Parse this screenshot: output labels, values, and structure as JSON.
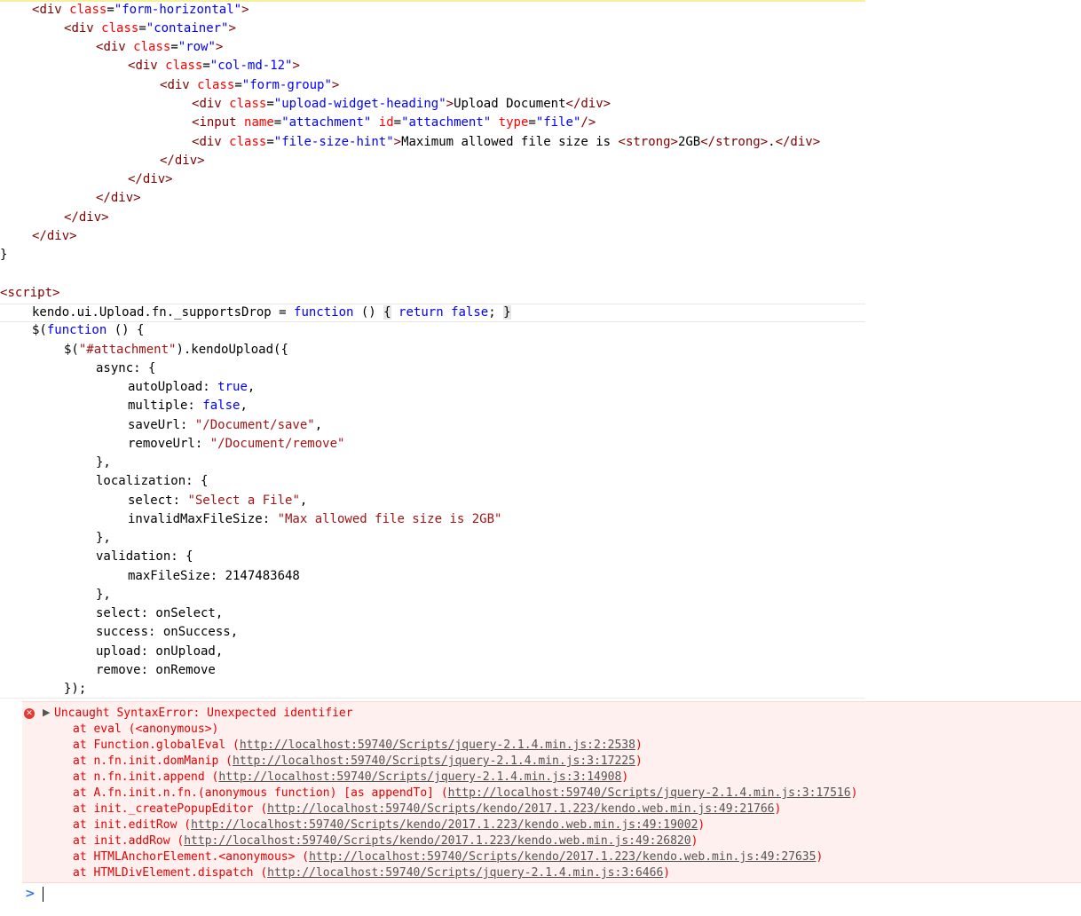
{
  "code": {
    "html": {
      "l1": {
        "tag": "div",
        "attr": "class",
        "val": "\"form-horizontal\""
      },
      "l2": {
        "tag": "div",
        "attr": "class",
        "val": "\"container\""
      },
      "l3": {
        "tag": "div",
        "attr": "class",
        "val": "\"row\""
      },
      "l4": {
        "tag": "div",
        "attr": "class",
        "val": "\"col-md-12\""
      },
      "l5": {
        "tag": "div",
        "attr": "class",
        "val": "\"form-group\""
      },
      "l6": {
        "tag": "div",
        "attr": "class",
        "val": "\"upload-widget-heading\"",
        "text": "Upload Document"
      },
      "l7": {
        "tag": "input",
        "attr1": "name",
        "val1": "\"attachment\"",
        "attr2": "id",
        "val2": "\"attachment\"",
        "attr3": "type",
        "val3": "\"file\""
      },
      "l8": {
        "tag": "div",
        "attr": "class",
        "val": "\"file-size-hint\"",
        "text": "Maximum allowed file size is ",
        "strong_tag": "strong",
        "strong_text": "2GB",
        "after": "."
      },
      "close_div": "div",
      "close_brace": "}",
      "script_tag": "script"
    },
    "js": {
      "supports_drop_pre": "kendo.ui.Upload.fn._supportsDrop = ",
      "kw_function": "function",
      "kw_return": "return",
      "kw_false": "false",
      "kw_true": "true",
      "selector_pre": "$(",
      "selector_str": "\"#attachment\"",
      "selector_post": ").kendoUpload({",
      "async_key": "async: {",
      "autoUpload": "autoUpload: ",
      "multiple": "multiple: ",
      "saveUrl": "saveUrl: ",
      "saveUrl_val": "\"/Document/save\"",
      "removeUrl": "removeUrl: ",
      "removeUrl_val": "\"/Document/remove\"",
      "localization_key": "localization: {",
      "select_key": "select: ",
      "select_val": "\"Select a File\"",
      "invalid_key": "invalidMaxFileSize: ",
      "invalid_val": "\"Max allowed file size is 2GB\"",
      "validation_key": "validation: {",
      "maxsize_line": "maxFileSize: 2147483648",
      "on_select": "select: onSelect,",
      "on_success": "success: onSuccess,",
      "on_upload": "upload: onUpload,",
      "on_remove": "remove: onRemove",
      "close_obj": "},",
      "close_call": "});"
    }
  },
  "console": {
    "error_message": "Uncaught SyntaxError: Unexpected identifier",
    "error_icon": "error-x-icon",
    "stack": [
      {
        "pre": "at eval (<anonymous>)",
        "link": "",
        "post": ""
      },
      {
        "pre": "at Function.globalEval (",
        "link": "http://localhost:59740/Scripts/jquery-2.1.4.min.js:2:2538",
        "post": ")"
      },
      {
        "pre": "at n.fn.init.domManip (",
        "link": "http://localhost:59740/Scripts/jquery-2.1.4.min.js:3:17225",
        "post": ")"
      },
      {
        "pre": "at n.fn.init.append (",
        "link": "http://localhost:59740/Scripts/jquery-2.1.4.min.js:3:14908",
        "post": ")"
      },
      {
        "pre": "at A.fn.init.n.fn.(anonymous function) [as appendTo] (",
        "link": "http://localhost:59740/Scripts/jquery-2.1.4.min.js:3:17516",
        "post": ")"
      },
      {
        "pre": "at init._createPopupEditor (",
        "link": "http://localhost:59740/Scripts/kendo/2017.1.223/kendo.web.min.js:49:21766",
        "post": ")"
      },
      {
        "pre": "at init.editRow (",
        "link": "http://localhost:59740/Scripts/kendo/2017.1.223/kendo.web.min.js:49:19002",
        "post": ")"
      },
      {
        "pre": "at init.addRow (",
        "link": "http://localhost:59740/Scripts/kendo/2017.1.223/kendo.web.min.js:49:26820",
        "post": ")"
      },
      {
        "pre": "at HTMLAnchorElement.<anonymous> (",
        "link": "http://localhost:59740/Scripts/kendo/2017.1.223/kendo.web.min.js:49:27635",
        "post": ")"
      },
      {
        "pre": "at HTMLDivElement.dispatch (",
        "link": "http://localhost:59740/Scripts/jquery-2.1.4.min.js:3:6466",
        "post": ")"
      }
    ],
    "prompt_symbol": ">"
  },
  "colors": {
    "tag": "#800000",
    "attribute": "#ff0000",
    "attr_value": "#0000ff",
    "keyword": "#0000ff",
    "string": "#a31515",
    "error_text": "#e60000",
    "error_bg": "#fff0f0",
    "prompt": "#367cf1"
  }
}
